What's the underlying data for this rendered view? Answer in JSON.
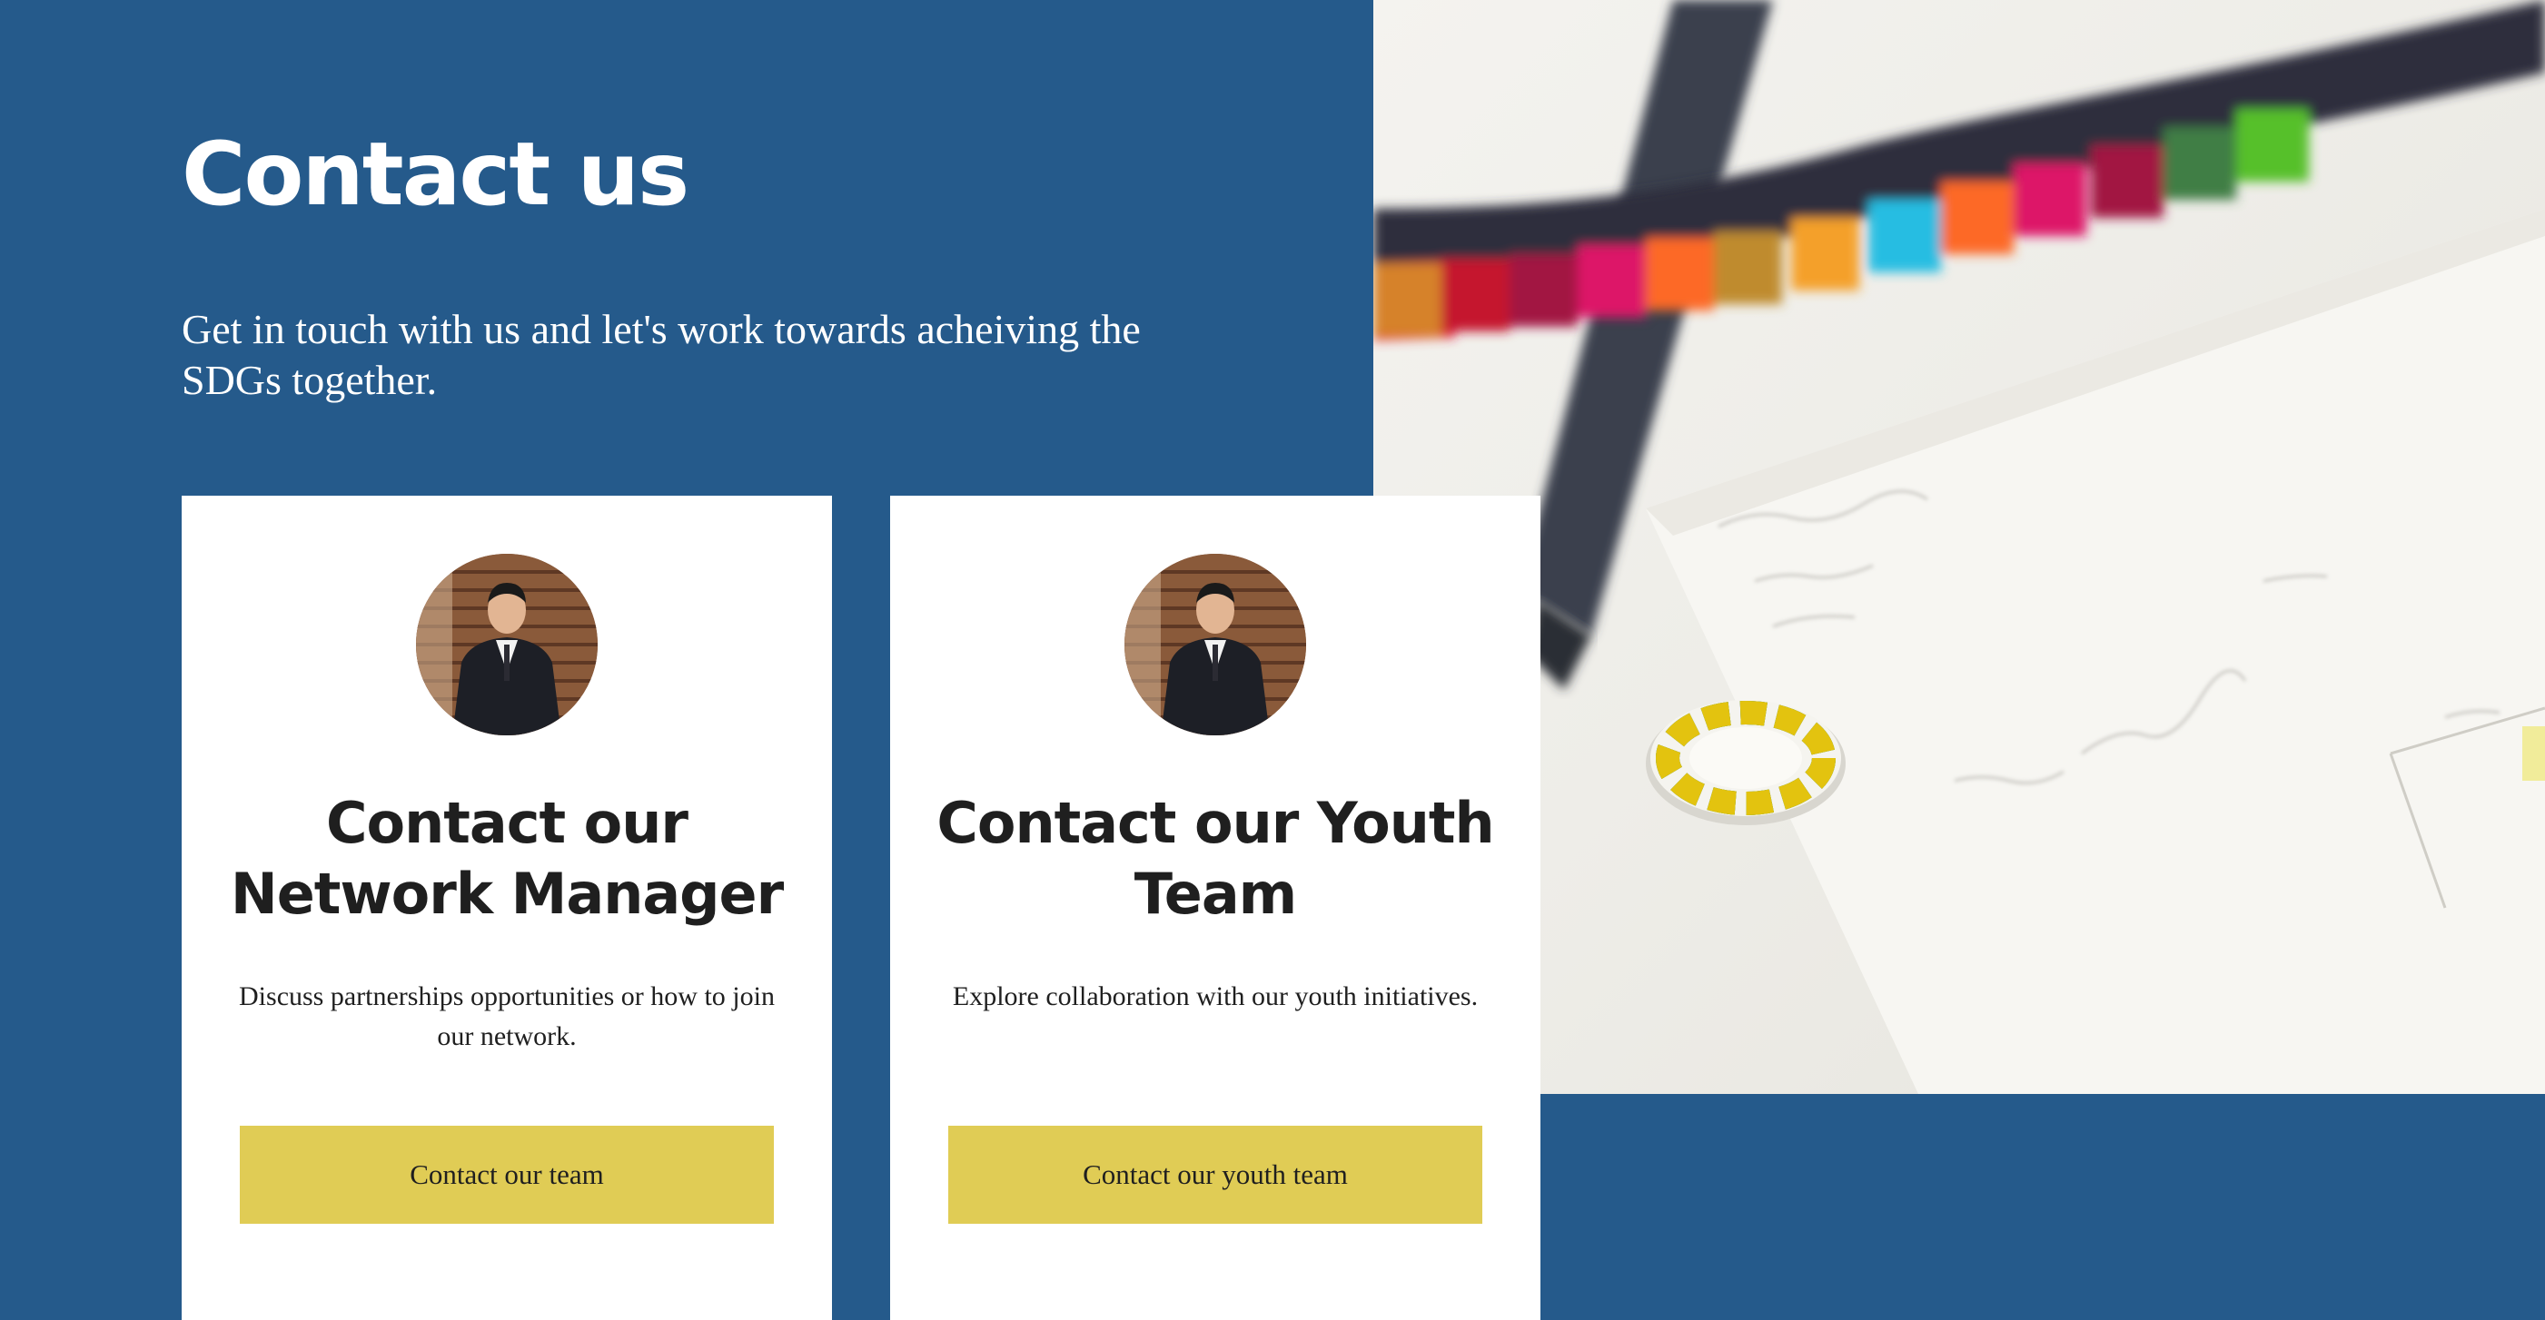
{
  "hero": {
    "title": "Contact us",
    "subtitle": "Get in touch with us and let's work towards acheiving the SDGs together."
  },
  "cards": [
    {
      "title": "Contact our Network Manager",
      "description": "Discuss partnerships opportunities or how to join our network.",
      "button_label": "Contact our team"
    },
    {
      "title": "Contact our Youth Team",
      "description": "Explore collaboration with our youth initiatives.",
      "button_label": "Contact our youth team"
    }
  ],
  "colors": {
    "background": "#255a8b",
    "card": "#ffffff",
    "button": "#e0cc55",
    "text_dark": "#1f1f1f",
    "text_light": "#ffffff"
  }
}
